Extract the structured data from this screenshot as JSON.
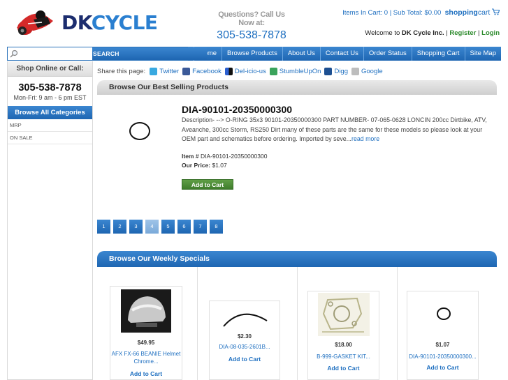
{
  "brand": {
    "dk": "DK",
    "cycle": "CYCLE"
  },
  "header": {
    "questions_label": "Questions? Call Us Now at:",
    "phone": "305-538-7878",
    "cart_text": "Items In Cart: 0 | Sub Total: $0.00",
    "shopping_word": "shopping",
    "cart_word": "cart",
    "welcome_prefix": "Welcome to",
    "company": "DK Cycle Inc.",
    "register": "Register",
    "login": "Login",
    "separator": "|"
  },
  "search": {
    "placeholder": "",
    "button": "SEARCH"
  },
  "nav": [
    "Home",
    "Browse Products",
    "About Us",
    "Contact Us",
    "Order Status",
    "Shopping Cart",
    "Site Map"
  ],
  "sidebar": {
    "shop_online": "Shop Online or Call:",
    "phone": "305-538-7878",
    "hours": "Mon-Fri: 9 am - 6 pm EST",
    "browse_all": "Browse All Categories",
    "links": [
      "MRP",
      "ON SALE"
    ]
  },
  "share": {
    "label": "Share this page:",
    "items": [
      {
        "label": "Twitter",
        "color": "#39a9e0"
      },
      {
        "label": "Facebook",
        "color": "#3b5998"
      },
      {
        "label": "Del-icio-us",
        "color": "#2a5fd0"
      },
      {
        "label": "StumbleUpOn",
        "color": "#3aa35b"
      },
      {
        "label": "Digg",
        "color": "#1d4f91"
      },
      {
        "label": "Google",
        "color": "#8a8a8a"
      }
    ]
  },
  "best_selling": {
    "title": "Browse Our Best Selling Products",
    "product_title": "DIA-90101-20350000300",
    "description": "Description- --> O-RING 35x3 90101-20350000300 PART NUMBER- 07-065-0628 LONCIN 200cc Dirtbike, ATV, Aveanche, 300cc Storm, RS250 Dirt many of these parts are the same for these models so please look at your OEM part and schematics before ordering. Imported by seve...",
    "read_more": "read more",
    "item_label": "Item #",
    "item_number": "DIA-90101-20350000300",
    "price_label": "Our Price:",
    "price": "$1.07",
    "add_to_cart": "Add to Cart",
    "pages": [
      "1",
      "2",
      "3",
      "4",
      "5",
      "6",
      "7",
      "8"
    ],
    "active_page": "4"
  },
  "weekly": {
    "title": "Browse Our Weekly Specials",
    "items": [
      {
        "price": "$49.95",
        "name": "AFX FX-66 BEANIE Helmet Chrome...",
        "add": "Add to Cart",
        "image": "helmet-image"
      },
      {
        "price": "$2.30",
        "name": "DIA-08-035-2601B...",
        "add": "Add to Cart",
        "image": "cable-image"
      },
      {
        "price": "$18.00",
        "name": "B-999-GASKET KIT...",
        "add": "Add to Cart",
        "image": "gasket-kit-image"
      },
      {
        "price": "$1.07",
        "name": "DIA-90101-20350000300...",
        "add": "Add to Cart",
        "image": "o-ring-image"
      }
    ]
  }
}
